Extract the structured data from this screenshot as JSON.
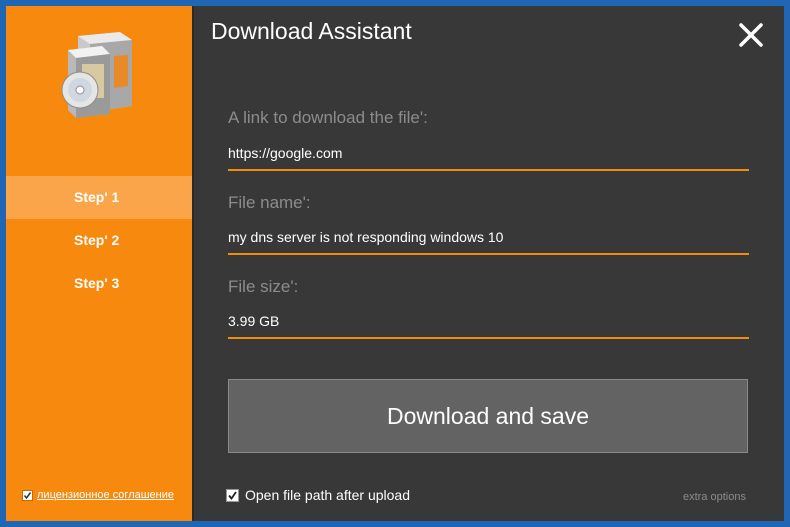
{
  "window": {
    "title": "Download Assistant"
  },
  "sidebar": {
    "steps": [
      {
        "label": "Step' 1",
        "active": true
      },
      {
        "label": "Step' 2",
        "active": false
      },
      {
        "label": "Step' 3",
        "active": false
      }
    ],
    "license": {
      "label": "лицензионное соглашение",
      "checked": true
    }
  },
  "form": {
    "link": {
      "label": "A link to download the file':",
      "value": "https://google.com"
    },
    "file_name": {
      "label": "File name':",
      "value": "my dns server is not responding windows 10"
    },
    "file_size": {
      "label": "File size':",
      "value": "3.99 GB"
    }
  },
  "actions": {
    "download_label": "Download and save",
    "open_path": {
      "label": "Open file path after upload",
      "checked": true
    },
    "extra_options": "extra options"
  },
  "colors": {
    "accent": "#f7890f",
    "active_step": "#fba54a",
    "panel": "#383838",
    "button": "#636363"
  }
}
